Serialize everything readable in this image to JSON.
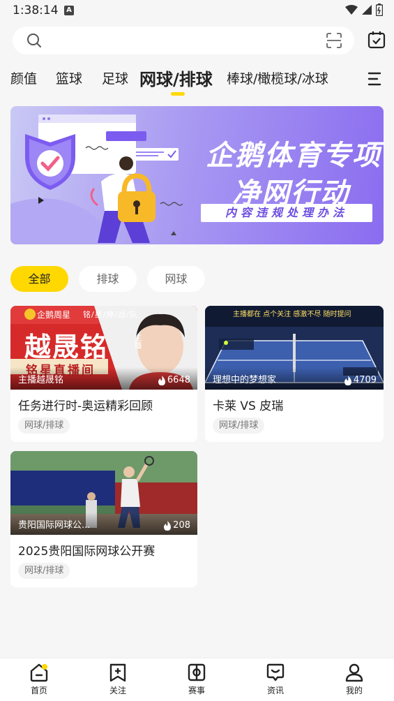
{
  "status_bar": {
    "time": "1:38:14",
    "notification_icon": "A"
  },
  "search": {
    "placeholder": ""
  },
  "tabs": [
    {
      "label": "颜值"
    },
    {
      "label": "篮球"
    },
    {
      "label": "足球"
    },
    {
      "label": "网球/排球",
      "active": true
    },
    {
      "label": "棒球/橄榄球/冰球"
    }
  ],
  "banner": {
    "title_line1": "企鹅体育专项",
    "title_line2": "净网行动",
    "subtitle": "内容违规处理办法"
  },
  "filters": [
    {
      "label": "全部",
      "active": true
    },
    {
      "label": "排球"
    },
    {
      "label": "网球"
    }
  ],
  "cards": [
    {
      "streamer": "主播越晟铭",
      "count": "6648",
      "title": "任务进行时-奥运精彩回顾",
      "tag": "网球/排球",
      "thumb": {
        "badge": "企鹅周星",
        "big_name": "越晟铭",
        "sub_banner": "铭星直播间",
        "top_strip": "铭/星/婷/战/队",
        "side_label": "主播"
      }
    },
    {
      "streamer": "理想中的梦想家",
      "count": "4709",
      "title": "卡莱 VS 皮瑞",
      "tag": "网球/排球",
      "thumb": {
        "banner": "主播都在 点个关注 感激不尽 随时提问"
      }
    },
    {
      "streamer": "贵阳国际网球公...",
      "count": "208",
      "title": "2025贵阳国际网球公开赛",
      "tag": "网球/排球",
      "thumb": {}
    }
  ],
  "bottom_nav": [
    {
      "label": "首页",
      "icon": "home-icon"
    },
    {
      "label": "关注",
      "icon": "follow-icon"
    },
    {
      "label": "赛事",
      "icon": "match-icon"
    },
    {
      "label": "资讯",
      "icon": "news-icon"
    },
    {
      "label": "我的",
      "icon": "profile-icon"
    }
  ],
  "colors": {
    "accent": "#ffd800",
    "banner_purple": "#8a6cf0"
  }
}
